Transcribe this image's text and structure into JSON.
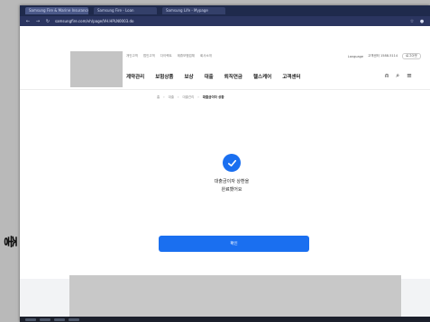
{
  "side_glyph": "좋",
  "browser": {
    "tabs": [
      "Samsung Fire & Marine Insurance",
      "Samsung Fire - Loan",
      "Samsung Life - Mypage"
    ],
    "url": "samsungfire.com/vh/page/VH.HPLN0003.do"
  },
  "header": {
    "util_links": [
      "개인고객",
      "법인고객",
      "다이렉트",
      "제휴보험업체",
      "회사소개"
    ],
    "util_right": [
      "Language",
      "고객센터 1588-5114",
      "로그아웃"
    ],
    "gnb": [
      "계약관리",
      "보험상품",
      "보상",
      "대출",
      "퇴직연금",
      "헬스케어",
      "고객센터"
    ],
    "icons": {
      "user": "user-icon",
      "search": "search-icon",
      "menu": "menu-icon"
    }
  },
  "breadcrumb": [
    "홈",
    "대출",
    "대출관리",
    "대출금이자 상환"
  ],
  "result": {
    "line1": "대출금이자 상환을",
    "line2": "완료했어요"
  },
  "confirm_label": "확인",
  "colors": {
    "accent": "#1a6ff0"
  }
}
